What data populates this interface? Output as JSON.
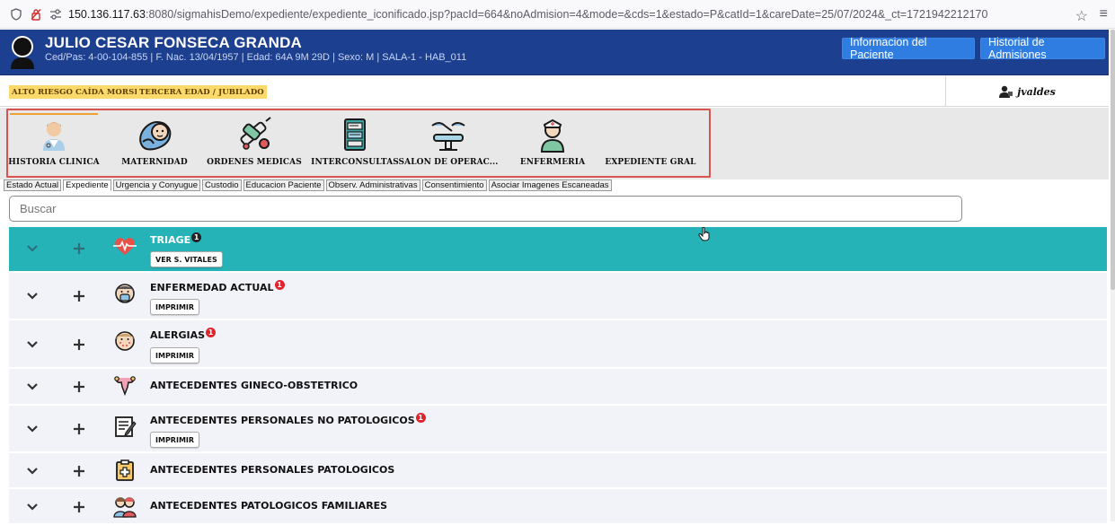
{
  "browser": {
    "url_host": "150.136.117.63",
    "url_rest": ":8080/sigmahisDemo/expediente/expediente_iconificado.jsp?pacId=664&noAdmision=4&mode=&cds=1&estado=P&catId=1&careDate=25/07/2024&_ct=1721942212170"
  },
  "patient": {
    "name": "JULIO CESAR FONSECA GRANDA",
    "info": "Ced/Pas: 4-00-104-855 | F. Nac. 13/04/1957 | Edad: 64A 9M 29D | Sexo: M  | SALA-1  - HAB_011",
    "btn_info": "Informacion del Paciente",
    "btn_history": "Historial de Admisiones"
  },
  "alerts": [
    "ALTO RIESGO CAÍDA MORSE",
    "TERCERA EDAD / JUBILADO"
  ],
  "user": "jvaldes",
  "modules": [
    {
      "label": "HISTORIA CLINICA",
      "icon": "doctor-icon"
    },
    {
      "label": "MATERNIDAD",
      "icon": "baby-icon"
    },
    {
      "label": "ORDENES MEDICAS",
      "icon": "syringe-pills-icon"
    },
    {
      "label": "INTERCONSULTAS",
      "icon": "consult-icon"
    },
    {
      "label": "SALON DE OPERAC...",
      "icon": "operating-lamp-icon"
    },
    {
      "label": "ENFERMERIA",
      "icon": "nurse-icon"
    },
    {
      "label": "EXPEDIENTE GRAL",
      "icon": ""
    }
  ],
  "tabs": [
    "Estado Actual",
    "Expediente",
    "Urgencia y Conyugue",
    "Custodio",
    "Educacion Paciente",
    "Observ. Administrativas",
    "Consentimiento",
    "Asociar Imagenes Escaneadas"
  ],
  "active_tab": "Expediente",
  "search": {
    "placeholder": "Buscar"
  },
  "sections": [
    {
      "title": "TRIAGE",
      "count": "1",
      "button": "VER S. VITALES",
      "icon": "heartbeat-icon",
      "highlight": true
    },
    {
      "title": "ENFERMEDAD ACTUAL",
      "count": "1",
      "button": "IMPRIMIR",
      "icon": "sick-face-icon"
    },
    {
      "title": "ALERGIAS",
      "count": "1",
      "button": "IMPRIMIR",
      "icon": "allergy-face-icon"
    },
    {
      "title": "ANTECEDENTES GINECO-OBSTETRICO",
      "count": "",
      "button": "",
      "icon": "uterus-icon"
    },
    {
      "title": "ANTECEDENTES PERSONALES NO PATOLOGICOS",
      "count": "1",
      "button": "IMPRIMIR",
      "icon": "edit-document-icon"
    },
    {
      "title": "ANTECEDENTES PERSONALES PATOLOGICOS",
      "count": "",
      "button": "",
      "icon": "clipboard-icon"
    },
    {
      "title": "ANTECEDENTES PATOLOGICOS FAMILIARES",
      "count": "",
      "button": "",
      "icon": "family-icon"
    }
  ]
}
